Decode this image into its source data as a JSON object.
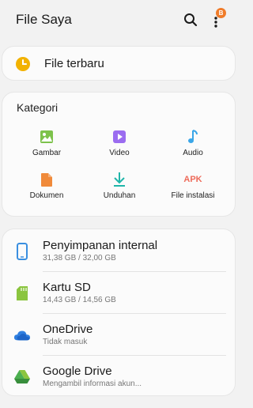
{
  "header": {
    "title": "File Saya",
    "badge": "B"
  },
  "recent": {
    "label": "File terbaru",
    "icon": "clock-icon",
    "color": "#f2b200"
  },
  "categories": {
    "title": "Kategori",
    "items": [
      {
        "label": "Gambar",
        "icon": "image-icon",
        "color": "#7dc24b"
      },
      {
        "label": "Video",
        "icon": "video-icon",
        "color": "#9b6cf0"
      },
      {
        "label": "Audio",
        "icon": "music-note-icon",
        "color": "#3aa6e8"
      },
      {
        "label": "Dokumen",
        "icon": "document-icon",
        "color": "#f08a3a"
      },
      {
        "label": "Unduhan",
        "icon": "download-icon",
        "color": "#1fb5a9"
      },
      {
        "label": "File instalasi",
        "icon": "apk-icon",
        "icon_text": "APK",
        "color": "#ee6b5a"
      }
    ]
  },
  "storage": [
    {
      "name": "Penyimpanan internal",
      "sub": "31,38 GB / 32,00 GB",
      "icon": "phone-icon",
      "color": "#3a8fe0"
    },
    {
      "name": "Kartu SD",
      "sub": "14,43 GB / 14,56 GB",
      "icon": "sd-card-icon",
      "color": "#8bc53f"
    },
    {
      "name": "OneDrive",
      "sub": "Tidak masuk",
      "icon": "cloud-icon",
      "color": "#2f7fe0"
    },
    {
      "name": "Google Drive",
      "sub": "Mengambil informasi akun...",
      "icon": "google-drive-icon",
      "color": "#4caf50"
    }
  ]
}
